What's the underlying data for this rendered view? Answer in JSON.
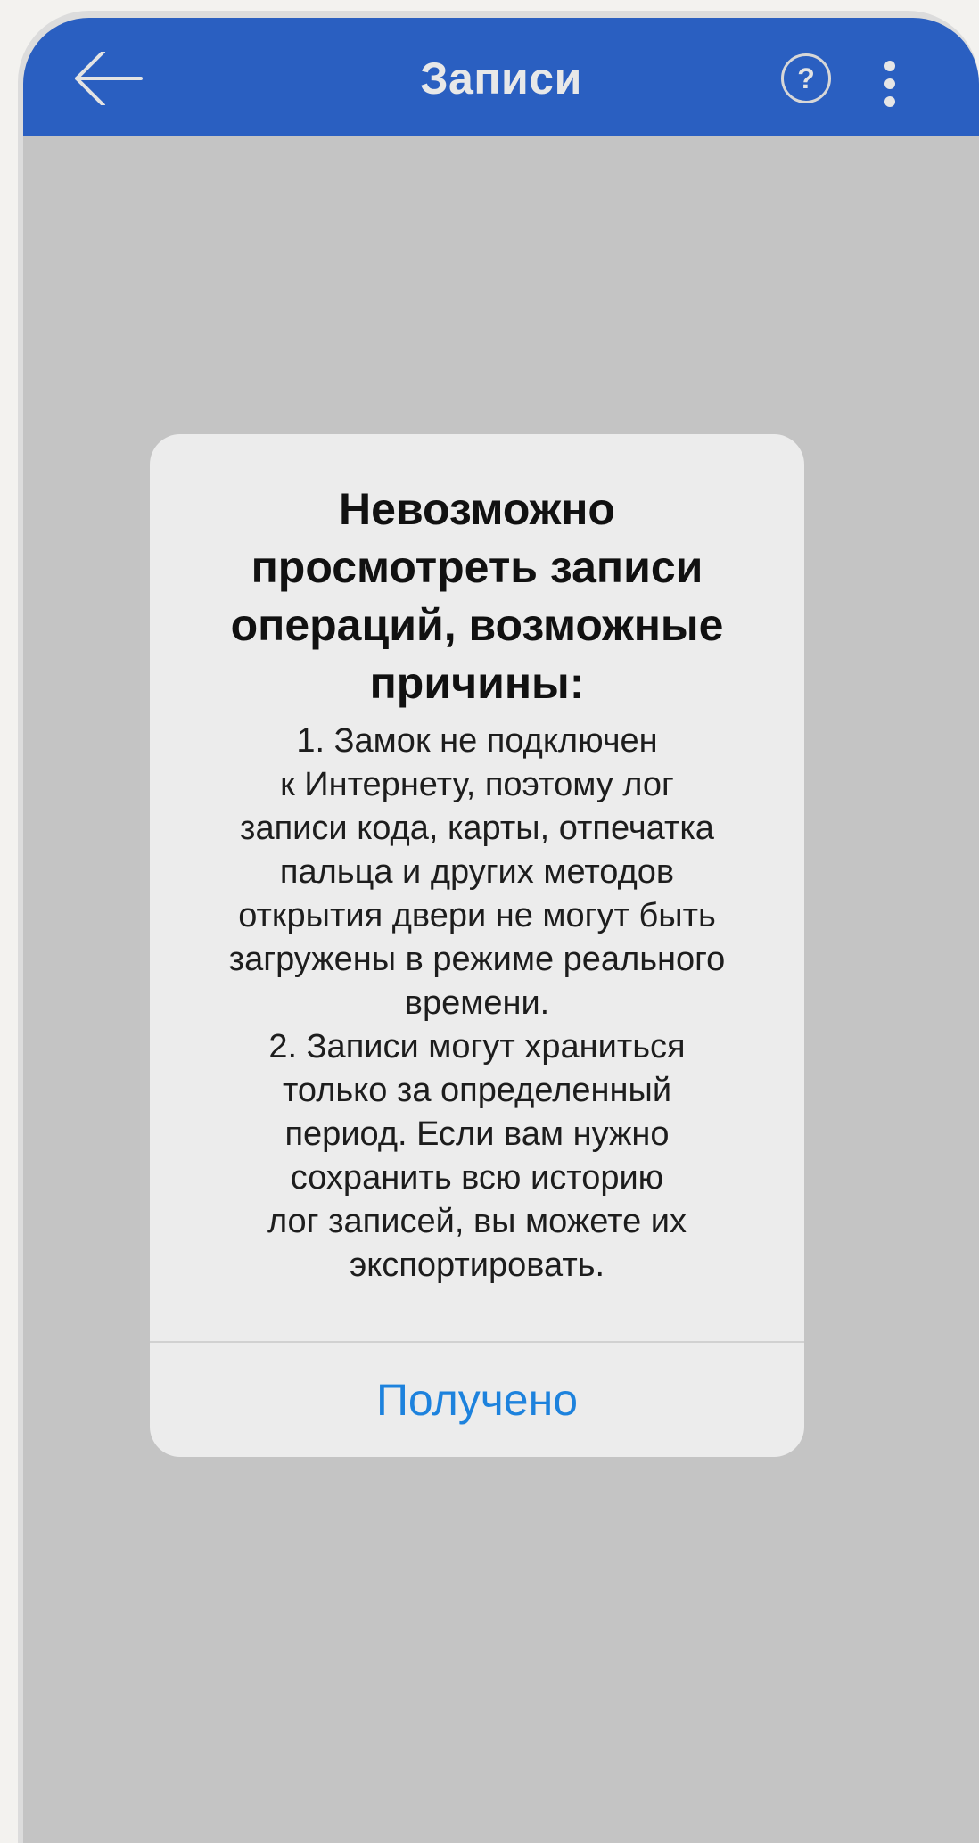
{
  "header": {
    "title": "Записи",
    "back_icon": "arrow-left-icon",
    "help_icon": "question-circle-icon",
    "help_label": "?",
    "more_icon": "more-vertical-icon",
    "background_color": "#2a5fc1"
  },
  "dialog": {
    "title": "Невозможно\nпросмотреть записи\nопераций, возможные\nпричины:",
    "message": "1. Замок не подключен\nк Интернету, поэтому лог\nзаписи кода, карты, отпечатка\nпальца и других методов\nоткрытия двери не могут быть\nзагружены в режиме реального\nвремени.\n2. Записи могут храниться\nтолько за определенный\nпериод. Если вам нужно\nсохранить всю историю\nлог записей, вы можете их\nэкспортировать.",
    "button_label": "Получено",
    "button_color": "#1d82dd"
  }
}
